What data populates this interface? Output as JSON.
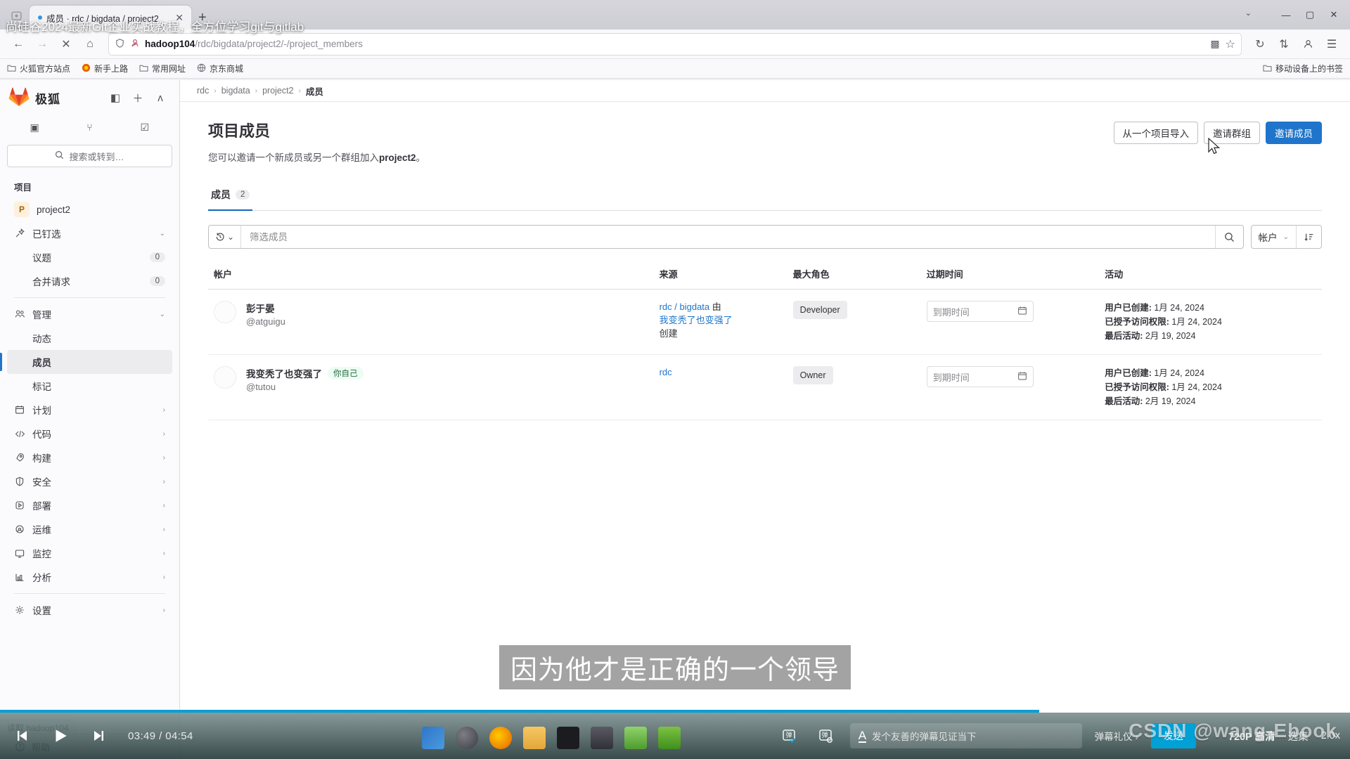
{
  "browser": {
    "tab": {
      "title": "成员 · rdc / bigdata / project2",
      "dot": "●",
      "close": "✕"
    },
    "newtab_label": "+",
    "window_controls": {
      "minimize": "—",
      "maximize": "▢",
      "close": "✕",
      "list_all_tabs": "⌄"
    },
    "nav": {
      "back": "←",
      "forward": "→",
      "stop": "✕",
      "home": "⌂"
    },
    "url": {
      "prefix": "hadoop104",
      "path": "/rdc/bigdata/project2/-/project_members",
      "shield": "⛉",
      "account": "👤"
    },
    "url_right": {
      "extension": "▩",
      "bookmark_star": "☆"
    },
    "toolbar_right": {
      "sync": "↻",
      "downloads": "⇅",
      "account": "👤",
      "menu": "☰"
    },
    "bookmarks": [
      {
        "label": "火狐官方站点",
        "icon": "folder-icon"
      },
      {
        "label": "新手上路",
        "icon": "firefox-icon"
      },
      {
        "label": "常用网址",
        "icon": "folder-icon"
      },
      {
        "label": "京东商城",
        "icon": "globe-icon"
      }
    ],
    "bookmarks_right": {
      "label": "移动设备上的书签",
      "icon": "folder-icon"
    }
  },
  "sidebar": {
    "brand": "极狐",
    "head_buttons": [
      {
        "name": "toggle-sidebar-button",
        "glyph": "◧"
      },
      {
        "name": "create-new-button",
        "glyph": "＋"
      },
      {
        "name": "user-avatar-button",
        "glyph": "ᴧ"
      }
    ],
    "quick_tabs": [
      {
        "name": "issues-tab",
        "glyph": "▣"
      },
      {
        "name": "merge-requests-tab",
        "glyph": "⑂"
      },
      {
        "name": "todos-tab",
        "glyph": "☑"
      }
    ],
    "search_placeholder": "搜索或转到…",
    "section_label": "项目",
    "project": {
      "initial": "P",
      "name": "project2"
    },
    "items": [
      {
        "label": "已钉选",
        "icon": "pin-icon",
        "trailing": "chevron-down",
        "level": 0
      },
      {
        "label": "议题",
        "icon": "",
        "count": "0",
        "level": 1
      },
      {
        "label": "合并请求",
        "icon": "",
        "count": "0",
        "level": 1
      },
      {
        "label": "管理",
        "icon": "users-icon",
        "trailing": "chevron-down",
        "level": 0
      },
      {
        "label": "动态",
        "icon": "",
        "level": 1
      },
      {
        "label": "成员",
        "icon": "",
        "level": 1,
        "active": true
      },
      {
        "label": "标记",
        "icon": "",
        "level": 1
      },
      {
        "label": "计划",
        "icon": "calendar-icon",
        "trailing": "chevron-right",
        "level": 0
      },
      {
        "label": "代码",
        "icon": "code-icon",
        "trailing": "chevron-right",
        "level": 0
      },
      {
        "label": "构建",
        "icon": "rocket-icon",
        "trailing": "chevron-right",
        "level": 0
      },
      {
        "label": "安全",
        "icon": "shield-icon",
        "trailing": "chevron-right",
        "level": 0
      },
      {
        "label": "部署",
        "icon": "deploy-icon",
        "trailing": "chevron-right",
        "level": 0
      },
      {
        "label": "运维",
        "icon": "operations-icon",
        "trailing": "chevron-right",
        "level": 0
      },
      {
        "label": "监控",
        "icon": "monitor-icon",
        "trailing": "chevron-right",
        "level": 0
      },
      {
        "label": "分析",
        "icon": "analytics-icon",
        "trailing": "chevron-right",
        "level": 0
      },
      {
        "label": "设置",
        "icon": "gear-icon",
        "trailing": "chevron-right",
        "level": 0
      }
    ],
    "help": {
      "label": "帮助",
      "icon": "help-icon"
    }
  },
  "breadcrumb": [
    {
      "label": "rdc"
    },
    {
      "label": "bigdata"
    },
    {
      "label": "project2"
    },
    {
      "label": "成员",
      "current": true
    }
  ],
  "page": {
    "title": "项目成员",
    "subtitle_pre": "您可以邀请一个新成员或另一个群组加入",
    "subtitle_project": "project2",
    "subtitle_post": "。",
    "actions": [
      {
        "label": "从一个项目导入",
        "name": "import-from-project-button",
        "style": "default"
      },
      {
        "label": "邀请群组",
        "name": "invite-group-button",
        "style": "default"
      },
      {
        "label": "邀请成员",
        "name": "invite-member-button",
        "style": "primary"
      }
    ],
    "tabs": [
      {
        "label": "成员",
        "badge": "2",
        "selected": true
      }
    ],
    "filter": {
      "history_icon": "history-icon",
      "placeholder": "筛选成员",
      "value": "",
      "search_icon": "search-icon",
      "sort_field": "帐户",
      "sort_dir_icon": "sort-ascending-icon"
    },
    "table": {
      "columns": [
        "帐户",
        "来源",
        "最大角色",
        "过期时间",
        "活动"
      ],
      "rows": [
        {
          "name": "彭于晏",
          "self_badge": "",
          "handle": "@atguigu",
          "source_link": "rdc / bigdata",
          "source_mid": "由",
          "source_link2": "我变秃了也变强了",
          "source_tail": "创建",
          "role": "Developer",
          "expires_placeholder": "到期时间",
          "activity": [
            {
              "label": "用户已创建:",
              "value": "1月 24, 2024"
            },
            {
              "label": "已授予访问权限:",
              "value": "1月 24, 2024"
            },
            {
              "label": "最后活动:",
              "value": "2月 19, 2024"
            }
          ]
        },
        {
          "name": "我变秃了也变强了",
          "self_badge": "你自己",
          "handle": "@tutou",
          "source_link": "rdc",
          "source_mid": "",
          "source_link2": "",
          "source_tail": "",
          "role": "Owner",
          "expires_placeholder": "到期时间",
          "activity": [
            {
              "label": "用户已创建:",
              "value": "1月 24, 2024"
            },
            {
              "label": "已授予访问权限:",
              "value": "1月 24, 2024"
            },
            {
              "label": "最后活动:",
              "value": "2月 19, 2024"
            }
          ]
        }
      ]
    }
  },
  "video": {
    "title": "尚硅谷2024最新Git企业实战教程，全方位学习git与gitlab",
    "subtitle": "因为他才是正确的一个领导",
    "current_time": "03:49",
    "total_time": "04:54",
    "time_display": "03:49 / 04:54",
    "controls": {
      "prev": "prev-icon",
      "play": "play-icon",
      "next": "next-icon",
      "danmu_toggle": "danmu-on-icon",
      "danmu_settings": "danmu-settings-icon",
      "font_icon": "A"
    },
    "danmu_placeholder": "发个友善的弹幕见证当下",
    "danmu_etiquette": "弹幕礼仪 ›",
    "send_label": "发送",
    "quality": "720P 高清",
    "episodes": "选集",
    "speed": "2.0x",
    "progress_percent": 77
  },
  "status_bar": {
    "text": "读取 hadoop104"
  },
  "watermark": "CSDN @wang-Ebook",
  "colors": {
    "accent": "#1f75cb",
    "bili_blue": "#00a1d6",
    "badge_green": "#24663b"
  }
}
